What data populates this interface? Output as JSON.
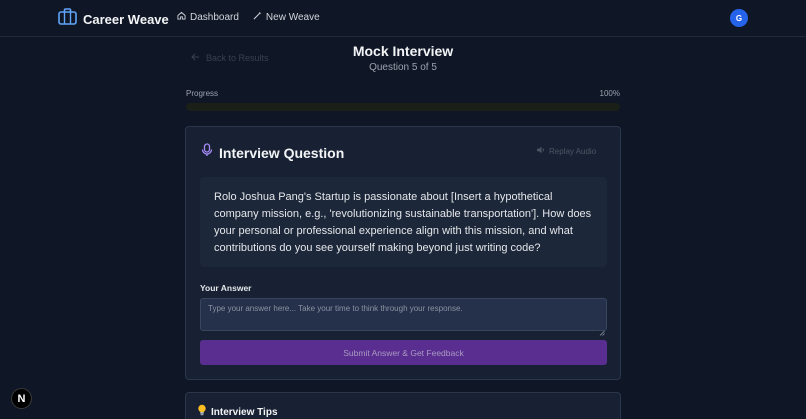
{
  "header": {
    "brand": "Career Weave",
    "nav": [
      {
        "label": "Dashboard",
        "icon": "home-icon"
      },
      {
        "label": "New Weave",
        "icon": "sparkle-wand-icon"
      }
    ],
    "avatar_initial": "G"
  },
  "page": {
    "back_label": "Back to Results",
    "title": "Mock Interview",
    "subtitle": "Question 5 of 5"
  },
  "progress": {
    "label": "Progress",
    "value_text": "100%",
    "value": 1.0
  },
  "card": {
    "title": "Interview Question",
    "title_icon": "microphone-icon",
    "replay_label": "Replay Audio",
    "question": "Rolo Joshua Pang's Startup is passionate about [Insert a hypothetical company mission, e.g., 'revolutionizing sustainable transportation']. How does your personal or professional experience align with this mission, and what contributions do you see yourself making beyond just writing code?",
    "answer_label": "Your Answer",
    "answer_value": "",
    "answer_placeholder": "Type your answer here... Take your time to think through your response.",
    "submit_label": "Submit Answer & Get Feedback"
  },
  "tips": {
    "title": "Interview Tips",
    "icon": "lightbulb-icon"
  },
  "badge": {
    "label": "N"
  },
  "colors": {
    "background": "#0f1626",
    "card": "#172133",
    "accent_purple": "#5a2d91",
    "avatar_blue": "#2563eb",
    "mic_purple": "#a78bfa"
  }
}
